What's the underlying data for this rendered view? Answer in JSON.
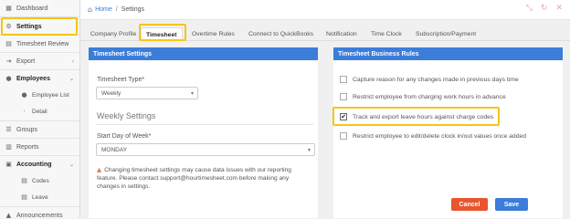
{
  "sidebar": {
    "items": [
      {
        "label": "Dashboard",
        "icon": "dashboard-icon"
      },
      {
        "label": "Settings",
        "icon": "gear-icon"
      },
      {
        "label": "Timesheet Review",
        "icon": "timesheet-icon"
      },
      {
        "label": "Export",
        "icon": "export-icon"
      },
      {
        "label": "Employees",
        "icon": "user-icon"
      },
      {
        "label": "Employee List",
        "icon": "person-icon"
      },
      {
        "label": "Detail",
        "icon": "dot-icon"
      },
      {
        "label": "Groups",
        "icon": "groups-icon"
      },
      {
        "label": "Reports",
        "icon": "reports-icon"
      },
      {
        "label": "Accounting",
        "icon": "accounting-icon"
      },
      {
        "label": "Codes",
        "icon": "codes-icon"
      },
      {
        "label": "Leave",
        "icon": "leave-icon"
      },
      {
        "label": "Announcements",
        "icon": "announcements-icon"
      }
    ]
  },
  "breadcrumb": {
    "home": "Home",
    "separator": "/",
    "current": "Settings"
  },
  "tabs": [
    {
      "label": "Company Profile"
    },
    {
      "label": "Timesheet"
    },
    {
      "label": "Overtime Rules"
    },
    {
      "label": "Connect to QuickBooks"
    },
    {
      "label": "Notification"
    },
    {
      "label": "Time Clock"
    },
    {
      "label": "Subscription/Payment"
    }
  ],
  "timesheet_settings": {
    "title": "Timesheet Settings",
    "type_label": "Timesheet Type*",
    "type_value": "Weekly",
    "weekly_title": "Weekly Settings",
    "start_day_label": "Start Day of Week*",
    "start_day_value": "MONDAY",
    "warning": "Changing timesheet settings may cause data issues with our reporting feature. Please contact support@hourtimesheet.com before making any changes in settings."
  },
  "business_rules": {
    "title": "Timesheet Business Rules",
    "rules": [
      {
        "label": "Capture reason for any changes made in previous days time",
        "checked": false
      },
      {
        "label": "Restrict employee from charging work hours in advance",
        "checked": false
      },
      {
        "label": "Track and export leave hours against charge codes",
        "checked": true
      },
      {
        "label": "Restrict employee to edit/delete clock in/out values once added",
        "checked": false
      }
    ]
  },
  "buttons": {
    "cancel": "Cancel",
    "save": "Save"
  },
  "colors": {
    "accent": "#3b7dd8",
    "cancel": "#e8552f",
    "highlight": "#f5c518"
  }
}
